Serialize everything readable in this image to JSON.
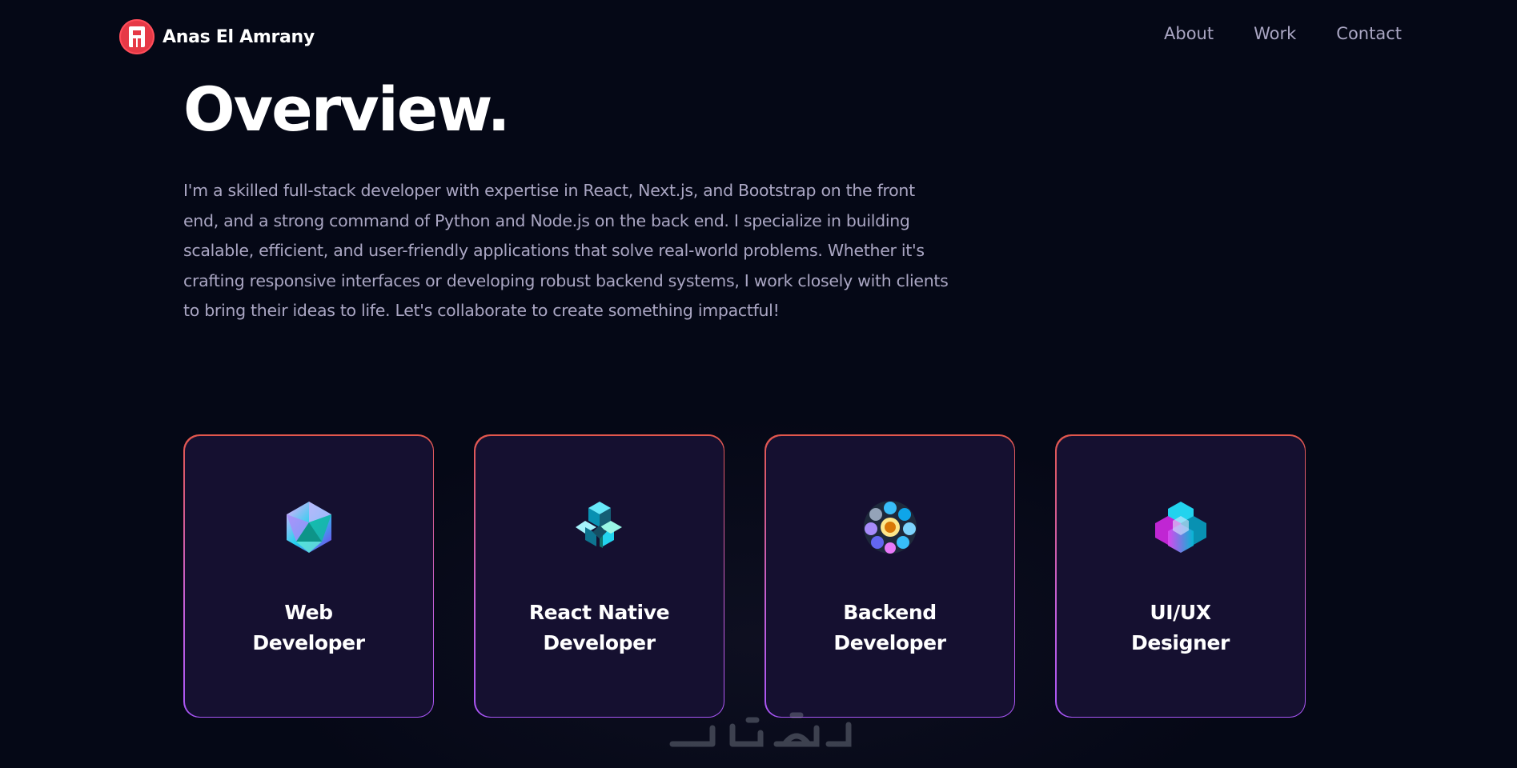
{
  "nav": {
    "brand_name": "Anas El Amrany",
    "links": [
      "About",
      "Work",
      "Contact"
    ]
  },
  "overview": {
    "title": "Overview.",
    "description": "I'm a skilled full-stack developer with expertise in React, Next.js, and Bootstrap on the front end, and a strong command of Python and Node.js on the back end. I specialize in building scalable, efficient, and user-friendly applications that solve real-world problems. Whether it's crafting responsive interfaces or developing robust backend systems, I work closely with clients to bring their ideas to life. Let's collaborate to create something impactful!"
  },
  "services": [
    {
      "title": "Web\nDeveloper",
      "icon": "icosahedron-icon"
    },
    {
      "title": "React Native\nDeveloper",
      "icon": "cube-lattice-icon"
    },
    {
      "title": "Backend\nDeveloper",
      "icon": "sphere-cluster-icon"
    },
    {
      "title": "UI/UX\nDesigner",
      "icon": "hexagon-cluster-icon"
    }
  ],
  "colors": {
    "background": "#050816",
    "card": "#151030",
    "secondary_text": "#aaa6c3",
    "logo_red": "#e63946"
  }
}
